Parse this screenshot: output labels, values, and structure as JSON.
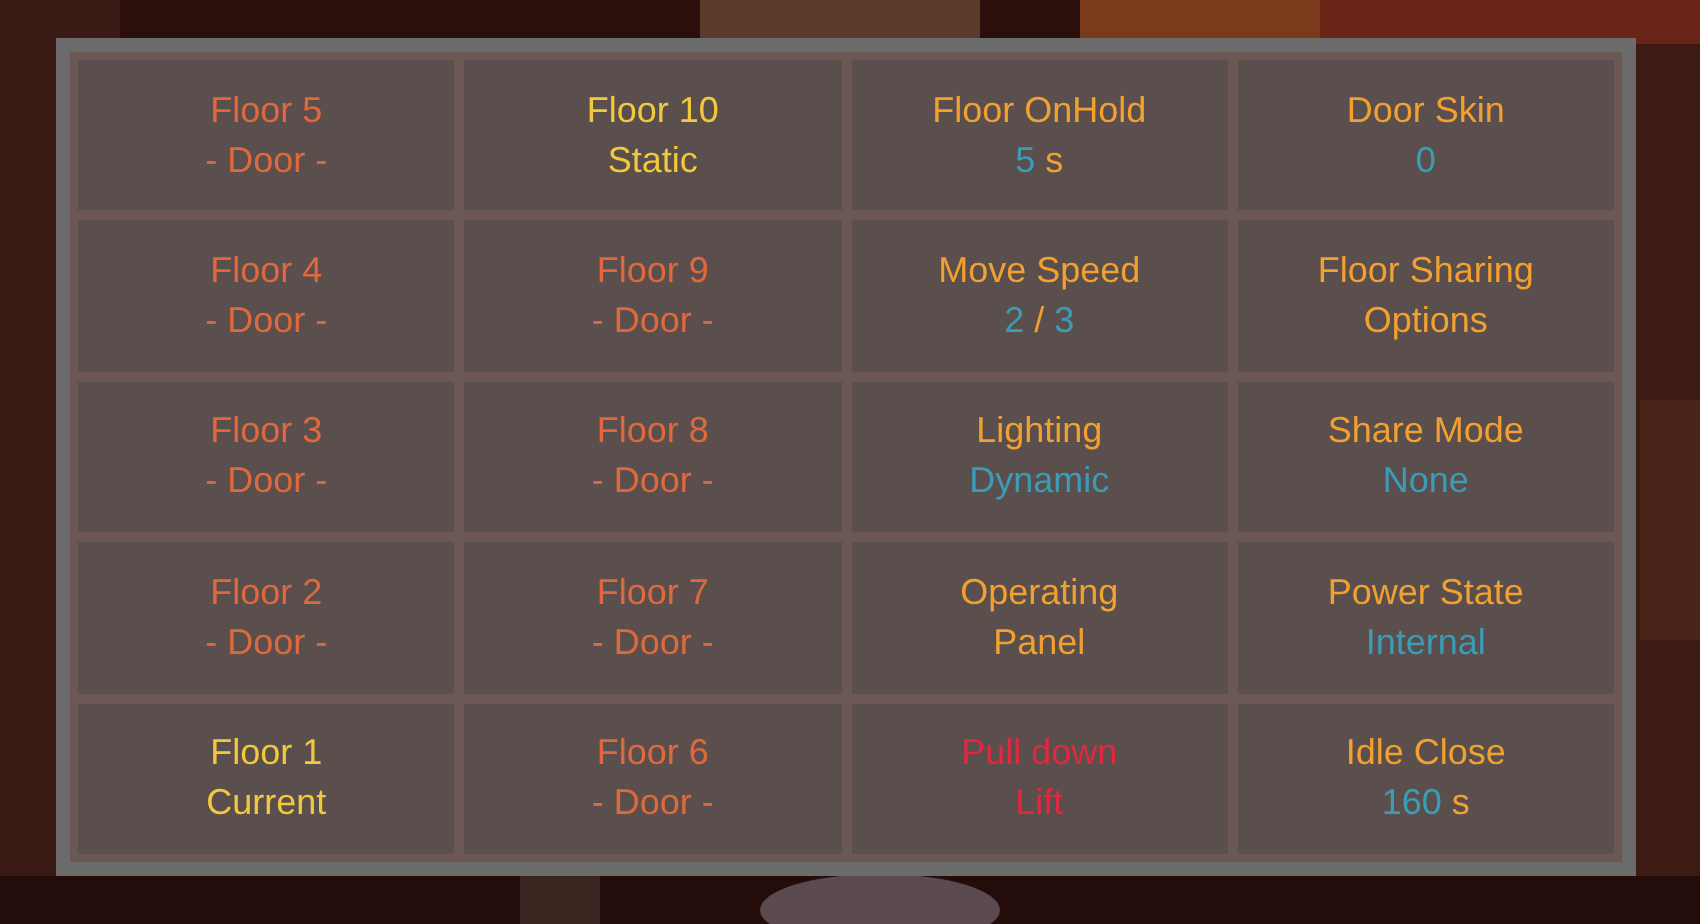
{
  "cells": [
    {
      "lines": [
        [
          {
            "text": "Floor 5",
            "color": "#e0693c"
          }
        ],
        [
          {
            "text": "- Door -",
            "color": "#e0693c"
          }
        ]
      ]
    },
    {
      "lines": [
        [
          {
            "text": "Floor 10",
            "color": "#f2c93a"
          }
        ],
        [
          {
            "text": "Static",
            "color": "#f2c93a"
          }
        ]
      ]
    },
    {
      "lines": [
        [
          {
            "text": "Floor OnHold",
            "color": "#f2a030"
          }
        ],
        [
          {
            "text": "5",
            "color": "#3a9cb6"
          },
          {
            "text": " s",
            "color": "#f2a030"
          }
        ]
      ]
    },
    {
      "lines": [
        [
          {
            "text": "Door Skin",
            "color": "#f2a030"
          }
        ],
        [
          {
            "text": "0",
            "color": "#3a9cb6"
          }
        ]
      ]
    },
    {
      "lines": [
        [
          {
            "text": "Floor 4",
            "color": "#e0693c"
          }
        ],
        [
          {
            "text": "- Door -",
            "color": "#e0693c"
          }
        ]
      ]
    },
    {
      "lines": [
        [
          {
            "text": "Floor 9",
            "color": "#e0693c"
          }
        ],
        [
          {
            "text": "- Door -",
            "color": "#e0693c"
          }
        ]
      ]
    },
    {
      "lines": [
        [
          {
            "text": "Move Speed",
            "color": "#f2a030"
          }
        ],
        [
          {
            "text": "2",
            "color": "#3a9cb6"
          },
          {
            "text": " / ",
            "color": "#f2a030"
          },
          {
            "text": "3",
            "color": "#3a9cb6"
          }
        ]
      ]
    },
    {
      "lines": [
        [
          {
            "text": "Floor Sharing",
            "color": "#f2a030"
          }
        ],
        [
          {
            "text": "Options",
            "color": "#f2a030"
          }
        ]
      ]
    },
    {
      "lines": [
        [
          {
            "text": "Floor 3",
            "color": "#e0693c"
          }
        ],
        [
          {
            "text": "- Door -",
            "color": "#e0693c"
          }
        ]
      ]
    },
    {
      "lines": [
        [
          {
            "text": "Floor 8",
            "color": "#e0693c"
          }
        ],
        [
          {
            "text": "- Door -",
            "color": "#e0693c"
          }
        ]
      ]
    },
    {
      "lines": [
        [
          {
            "text": "Lighting",
            "color": "#f2a030"
          }
        ],
        [
          {
            "text": "Dynamic",
            "color": "#3a9cb6"
          }
        ]
      ]
    },
    {
      "lines": [
        [
          {
            "text": "Share Mode",
            "color": "#f2a030"
          }
        ],
        [
          {
            "text": "None",
            "color": "#3a9cb6"
          }
        ]
      ]
    },
    {
      "lines": [
        [
          {
            "text": "Floor 2",
            "color": "#e0693c"
          }
        ],
        [
          {
            "text": "- Door -",
            "color": "#e0693c"
          }
        ]
      ]
    },
    {
      "lines": [
        [
          {
            "text": "Floor 7",
            "color": "#e0693c"
          }
        ],
        [
          {
            "text": "- Door -",
            "color": "#e0693c"
          }
        ]
      ]
    },
    {
      "lines": [
        [
          {
            "text": "Operating",
            "color": "#f2a030"
          }
        ],
        [
          {
            "text": "Panel",
            "color": "#f2a030"
          }
        ]
      ]
    },
    {
      "lines": [
        [
          {
            "text": "Power State",
            "color": "#f2a030"
          }
        ],
        [
          {
            "text": "Internal",
            "color": "#3a9cb6"
          }
        ]
      ]
    },
    {
      "lines": [
        [
          {
            "text": "Floor 1",
            "color": "#f2c93a"
          }
        ],
        [
          {
            "text": "Current",
            "color": "#f2c93a"
          }
        ]
      ]
    },
    {
      "lines": [
        [
          {
            "text": "Floor 6",
            "color": "#e0693c"
          }
        ],
        [
          {
            "text": "- Door -",
            "color": "#e0693c"
          }
        ]
      ]
    },
    {
      "lines": [
        [
          {
            "text": "Pull down",
            "color": "#e0283e"
          }
        ],
        [
          {
            "text": "Lift",
            "color": "#e0283e"
          }
        ]
      ]
    },
    {
      "lines": [
        [
          {
            "text": "Idle Close",
            "color": "#f2a030"
          }
        ],
        [
          {
            "text": "160",
            "color": "#3a9cb6"
          },
          {
            "text": " s",
            "color": "#f2a030"
          }
        ]
      ]
    }
  ]
}
